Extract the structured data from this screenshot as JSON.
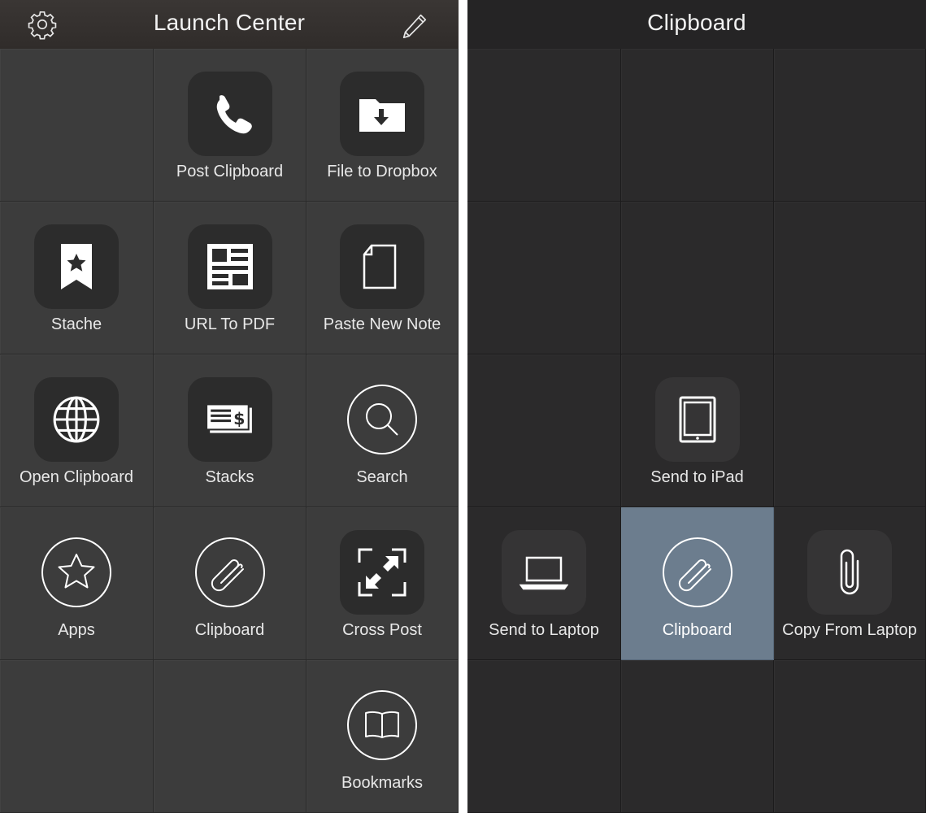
{
  "left": {
    "title": "Launch Center",
    "settings_icon": "gear-icon",
    "edit_icon": "pencil-icon",
    "actions": [
      {
        "label": "Post Clipboard",
        "icon": "phone-icon"
      },
      {
        "label": "File to Dropbox",
        "icon": "folder-download-icon"
      },
      {
        "label": "Stache",
        "icon": "bookmark-star-icon"
      },
      {
        "label": "URL To PDF",
        "icon": "newspaper-icon"
      },
      {
        "label": "Paste New Note",
        "icon": "document-icon"
      },
      {
        "label": "Open Clipboard",
        "icon": "globe-icon"
      },
      {
        "label": "Stacks",
        "icon": "cheque-icon"
      },
      {
        "label": "Search",
        "icon": "search-icon"
      },
      {
        "label": "Apps",
        "icon": "star-icon"
      },
      {
        "label": "Clipboard",
        "icon": "paperclip-icon"
      },
      {
        "label": "Cross Post",
        "icon": "expand-arrows-icon"
      },
      {
        "label": "Bookmarks",
        "icon": "book-icon"
      }
    ]
  },
  "right": {
    "title": "Clipboard",
    "actions": [
      {
        "label": "Send to iPad",
        "icon": "ipad-icon"
      },
      {
        "label": "Send to Laptop",
        "icon": "laptop-icon"
      },
      {
        "label": "Clipboard",
        "icon": "paperclip-icon",
        "selected": true
      },
      {
        "label": "Copy From Laptop",
        "icon": "paperclip-vertical-icon"
      }
    ]
  },
  "colors": {
    "left_background": "#3c3c3c",
    "right_background": "#2b2a2b",
    "divider": "#ffffff",
    "selected_cell": "#6c7d8e",
    "text": "#e8e8e8"
  }
}
